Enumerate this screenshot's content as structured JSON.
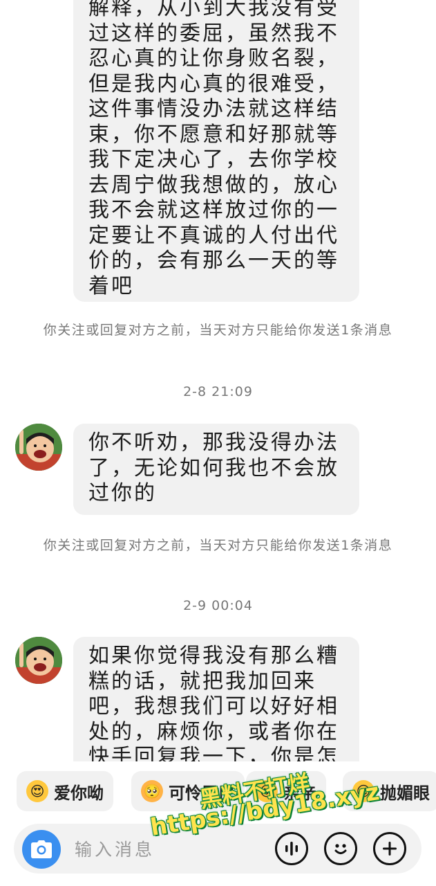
{
  "messages": [
    {
      "text": "解释，从小到大我没有受过这样的委屈，虽然我不忍心真的让你身败名裂，但是我内心真的很难受，这件事情没办法就这样结束，你不愿意和好那就等我下定决心了，去你学校去周宁做我想做的，放心我不会就这样放过你的一定要让不真诚的人付出代价的，会有那么一天的等着吧"
    },
    {
      "text": "你不听劝，那我没得办法了，无论如何我也不会放过你的"
    },
    {
      "text": "如果你觉得我没有那么糟糕的话，就把我加回来吧，我想我们可以好好相处的，麻烦你，或者你在快手回复我一下，你是怎"
    }
  ],
  "notices": [
    {
      "text": "你关注或回复对方之前，当天对方只能给你发送1条消息"
    },
    {
      "text": "你关注或回复对方之前，当天对方只能给你发送1条消息"
    }
  ],
  "timestamps": [
    "2-8 21:09",
    "2-9 00:04"
  ],
  "quick_replies": [
    {
      "label": "爱你呦",
      "icon": "heart-eyes-emoji-icon"
    },
    {
      "label": "可怜巴巴",
      "icon": "pleading-cat-emoji-icon"
    },
    {
      "label": "亲亲",
      "icon": "kiss-emoji-icon"
    },
    {
      "label": "抛媚眼",
      "icon": "wink-emoji-icon"
    }
  ],
  "input": {
    "placeholder": "输入消息"
  },
  "icons": {
    "camera": "camera-icon",
    "voice": "voice-wave-icon",
    "emoji": "smile-icon",
    "more": "plus-icon"
  },
  "colors": {
    "camera_button": "#3a8ff0",
    "bubble": "#f1f1f1",
    "notice_text": "#777777"
  },
  "watermark": {
    "line1": "黑料不打烊",
    "line2": "https://bdy18.xyz"
  }
}
